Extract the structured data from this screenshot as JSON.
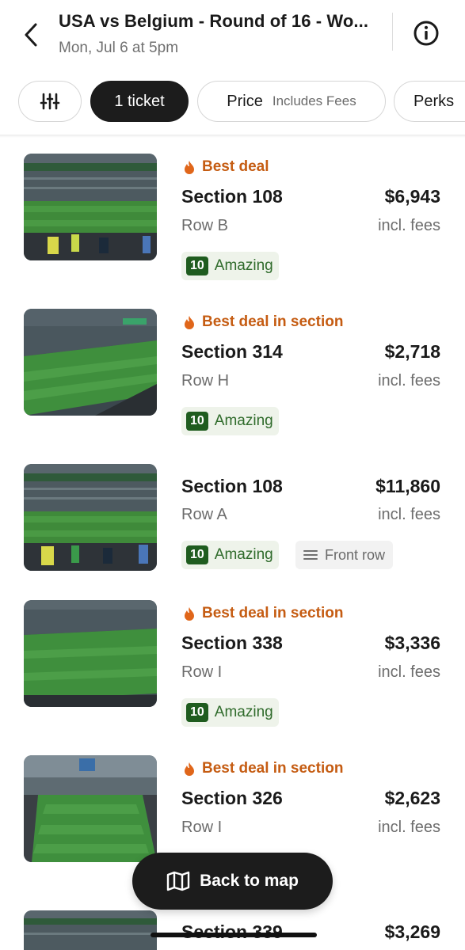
{
  "header": {
    "title": "USA vs Belgium - Round of 16 - Wo...",
    "subtitle": "Mon, Jul 6 at 5pm",
    "back_icon": "chevron-left-icon",
    "info_icon": "info-icon"
  },
  "filters": {
    "filter_icon": "sliders-icon",
    "ticket_label": "1 ticket",
    "price_label": "Price",
    "price_sub": "Includes Fees",
    "perks_label": "Perks"
  },
  "listings": [
    {
      "deal": "Best deal",
      "section": "Section 108",
      "price": "$6,943",
      "row": "Row B",
      "fees": "incl. fees",
      "score": "10",
      "rating": "Amazing"
    },
    {
      "deal": "Best deal in section",
      "section": "Section 314",
      "price": "$2,718",
      "row": "Row H",
      "fees": "incl. fees",
      "score": "10",
      "rating": "Amazing"
    },
    {
      "deal": "",
      "section": "Section 108",
      "price": "$11,860",
      "row": "Row A",
      "fees": "incl. fees",
      "score": "10",
      "rating": "Amazing",
      "perk": "Front row"
    },
    {
      "deal": "Best deal in section",
      "section": "Section 338",
      "price": "$3,336",
      "row": "Row I",
      "fees": "incl. fees",
      "score": "10",
      "rating": "Amazing"
    },
    {
      "deal": "Best deal in section",
      "section": "Section 326",
      "price": "$2,623",
      "row": "Row I",
      "fees": "incl. fees"
    },
    {
      "section": "Section 339",
      "price": "$3,269"
    }
  ],
  "map_button": {
    "label": "Back to map",
    "icon": "map-icon"
  },
  "colors": {
    "accent_dark": "#1c1c1c",
    "deal_orange": "#c55c12",
    "rating_green": "#1f5c1f",
    "muted_text": "#6d6d6d"
  }
}
